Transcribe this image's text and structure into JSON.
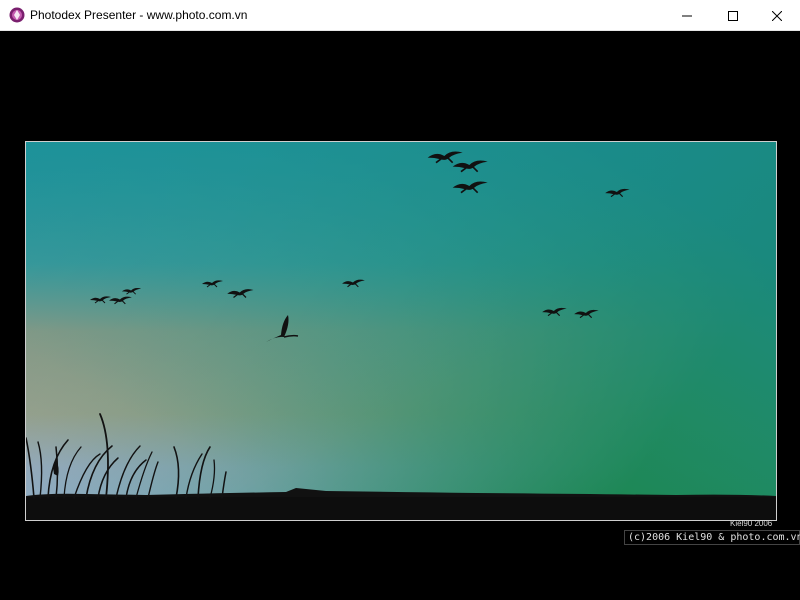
{
  "window": {
    "title": "Photodex Presenter - www.photo.com.vn",
    "app_icon": "photodex-logo-icon",
    "controls": {
      "minimize": "minimize-icon",
      "maximize": "maximize-icon",
      "close": "close-icon"
    }
  },
  "slide": {
    "photo_credit": "Kiel90 2006",
    "copyright": "(c)2006 Kiel90 & photo.com.vn",
    "colors": {
      "sky_top": "#168f8f",
      "sky_green": "#0d7a3a",
      "sky_orange": "#f2a46c",
      "horizon_lilac": "#d9b8e8",
      "background": "#000000"
    }
  }
}
